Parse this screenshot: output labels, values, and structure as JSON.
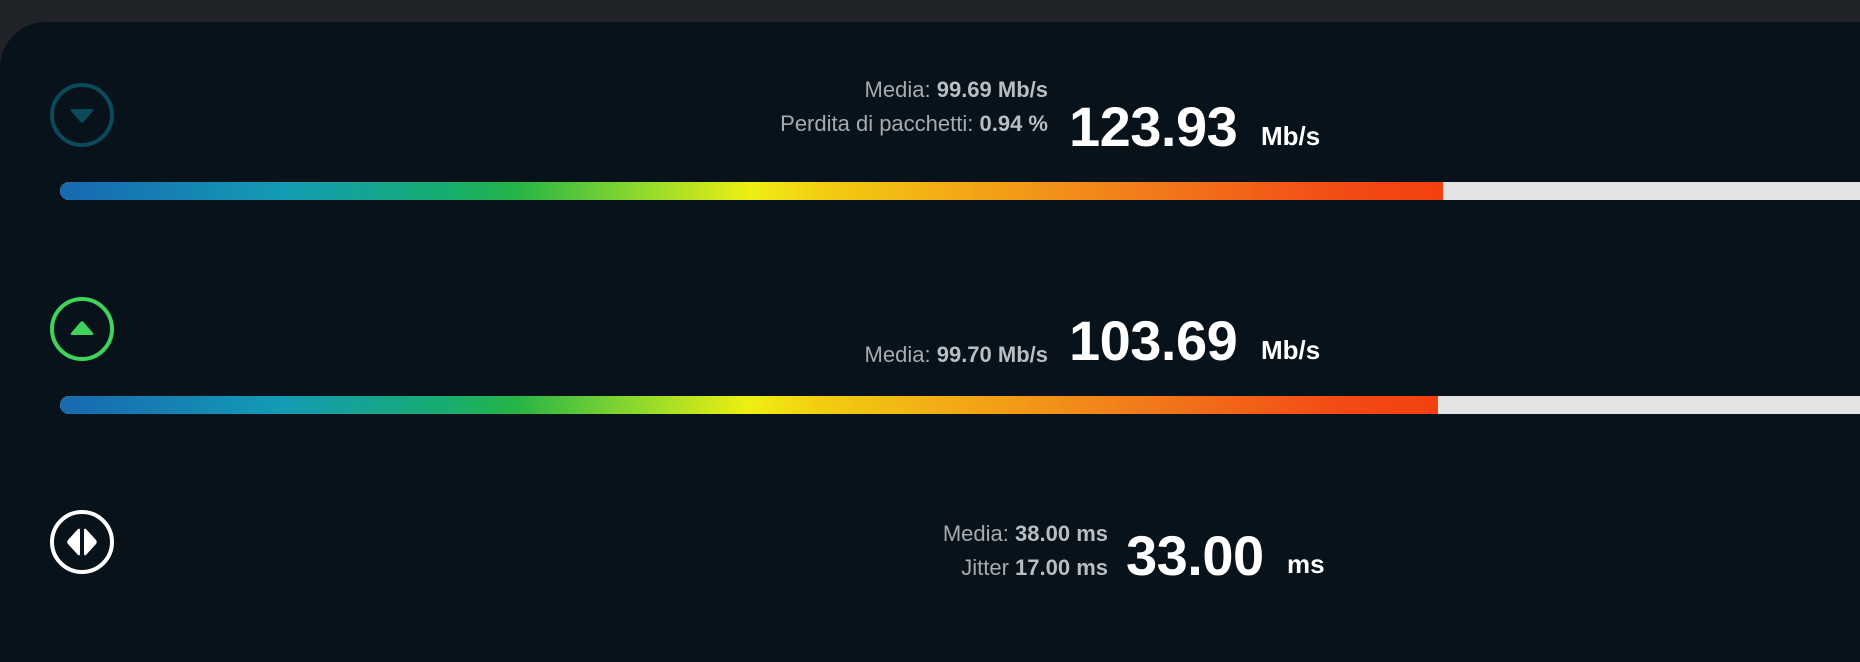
{
  "download": {
    "icon": "arrow-down-circle-icon",
    "icon_color": "#0b4a5a",
    "avg_label": "Media:",
    "avg_value": "99.69 Mb/s",
    "loss_label": "Perdita di pacchetti:",
    "loss_value": "0.94 %",
    "value": "123.93",
    "unit": "Mb/s",
    "bar_fill_fraction": 0.76
  },
  "upload": {
    "icon": "arrow-up-circle-icon",
    "icon_color": "#3ed35a",
    "avg_label": "Media:",
    "avg_value": "99.70 Mb/s",
    "value": "103.69",
    "unit": "Mb/s",
    "bar_fill_fraction": 0.757
  },
  "ping": {
    "icon": "ping-circle-icon",
    "icon_color": "#ffffff",
    "avg_label": "Media:",
    "avg_value": "38.00 ms",
    "jitter_label": "Jitter",
    "jitter_value": "17.00 ms",
    "value": "33.00",
    "unit": "ms"
  },
  "colors": {
    "background": "#07121a",
    "bar_track": "#e3e3e3",
    "gradient_start": "#1768b0",
    "gradient_mid": "#efef12",
    "gradient_end": "#f3410f"
  }
}
